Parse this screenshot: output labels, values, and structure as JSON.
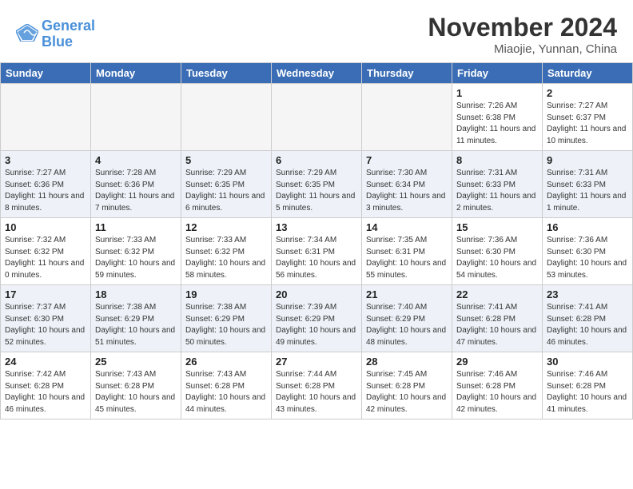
{
  "header": {
    "logo_line1": "General",
    "logo_line2": "Blue",
    "month_title": "November 2024",
    "subtitle": "Miaojie, Yunnan, China"
  },
  "weekdays": [
    "Sunday",
    "Monday",
    "Tuesday",
    "Wednesday",
    "Thursday",
    "Friday",
    "Saturday"
  ],
  "weeks": [
    [
      {
        "day": "",
        "info": ""
      },
      {
        "day": "",
        "info": ""
      },
      {
        "day": "",
        "info": ""
      },
      {
        "day": "",
        "info": ""
      },
      {
        "day": "",
        "info": ""
      },
      {
        "day": "1",
        "info": "Sunrise: 7:26 AM\nSunset: 6:38 PM\nDaylight: 11 hours and 11 minutes."
      },
      {
        "day": "2",
        "info": "Sunrise: 7:27 AM\nSunset: 6:37 PM\nDaylight: 11 hours and 10 minutes."
      }
    ],
    [
      {
        "day": "3",
        "info": "Sunrise: 7:27 AM\nSunset: 6:36 PM\nDaylight: 11 hours and 8 minutes."
      },
      {
        "day": "4",
        "info": "Sunrise: 7:28 AM\nSunset: 6:36 PM\nDaylight: 11 hours and 7 minutes."
      },
      {
        "day": "5",
        "info": "Sunrise: 7:29 AM\nSunset: 6:35 PM\nDaylight: 11 hours and 6 minutes."
      },
      {
        "day": "6",
        "info": "Sunrise: 7:29 AM\nSunset: 6:35 PM\nDaylight: 11 hours and 5 minutes."
      },
      {
        "day": "7",
        "info": "Sunrise: 7:30 AM\nSunset: 6:34 PM\nDaylight: 11 hours and 3 minutes."
      },
      {
        "day": "8",
        "info": "Sunrise: 7:31 AM\nSunset: 6:33 PM\nDaylight: 11 hours and 2 minutes."
      },
      {
        "day": "9",
        "info": "Sunrise: 7:31 AM\nSunset: 6:33 PM\nDaylight: 11 hours and 1 minute."
      }
    ],
    [
      {
        "day": "10",
        "info": "Sunrise: 7:32 AM\nSunset: 6:32 PM\nDaylight: 11 hours and 0 minutes."
      },
      {
        "day": "11",
        "info": "Sunrise: 7:33 AM\nSunset: 6:32 PM\nDaylight: 10 hours and 59 minutes."
      },
      {
        "day": "12",
        "info": "Sunrise: 7:33 AM\nSunset: 6:32 PM\nDaylight: 10 hours and 58 minutes."
      },
      {
        "day": "13",
        "info": "Sunrise: 7:34 AM\nSunset: 6:31 PM\nDaylight: 10 hours and 56 minutes."
      },
      {
        "day": "14",
        "info": "Sunrise: 7:35 AM\nSunset: 6:31 PM\nDaylight: 10 hours and 55 minutes."
      },
      {
        "day": "15",
        "info": "Sunrise: 7:36 AM\nSunset: 6:30 PM\nDaylight: 10 hours and 54 minutes."
      },
      {
        "day": "16",
        "info": "Sunrise: 7:36 AM\nSunset: 6:30 PM\nDaylight: 10 hours and 53 minutes."
      }
    ],
    [
      {
        "day": "17",
        "info": "Sunrise: 7:37 AM\nSunset: 6:30 PM\nDaylight: 10 hours and 52 minutes."
      },
      {
        "day": "18",
        "info": "Sunrise: 7:38 AM\nSunset: 6:29 PM\nDaylight: 10 hours and 51 minutes."
      },
      {
        "day": "19",
        "info": "Sunrise: 7:38 AM\nSunset: 6:29 PM\nDaylight: 10 hours and 50 minutes."
      },
      {
        "day": "20",
        "info": "Sunrise: 7:39 AM\nSunset: 6:29 PM\nDaylight: 10 hours and 49 minutes."
      },
      {
        "day": "21",
        "info": "Sunrise: 7:40 AM\nSunset: 6:29 PM\nDaylight: 10 hours and 48 minutes."
      },
      {
        "day": "22",
        "info": "Sunrise: 7:41 AM\nSunset: 6:28 PM\nDaylight: 10 hours and 47 minutes."
      },
      {
        "day": "23",
        "info": "Sunrise: 7:41 AM\nSunset: 6:28 PM\nDaylight: 10 hours and 46 minutes."
      }
    ],
    [
      {
        "day": "24",
        "info": "Sunrise: 7:42 AM\nSunset: 6:28 PM\nDaylight: 10 hours and 46 minutes."
      },
      {
        "day": "25",
        "info": "Sunrise: 7:43 AM\nSunset: 6:28 PM\nDaylight: 10 hours and 45 minutes."
      },
      {
        "day": "26",
        "info": "Sunrise: 7:43 AM\nSunset: 6:28 PM\nDaylight: 10 hours and 44 minutes."
      },
      {
        "day": "27",
        "info": "Sunrise: 7:44 AM\nSunset: 6:28 PM\nDaylight: 10 hours and 43 minutes."
      },
      {
        "day": "28",
        "info": "Sunrise: 7:45 AM\nSunset: 6:28 PM\nDaylight: 10 hours and 42 minutes."
      },
      {
        "day": "29",
        "info": "Sunrise: 7:46 AM\nSunset: 6:28 PM\nDaylight: 10 hours and 42 minutes."
      },
      {
        "day": "30",
        "info": "Sunrise: 7:46 AM\nSunset: 6:28 PM\nDaylight: 10 hours and 41 minutes."
      }
    ]
  ]
}
